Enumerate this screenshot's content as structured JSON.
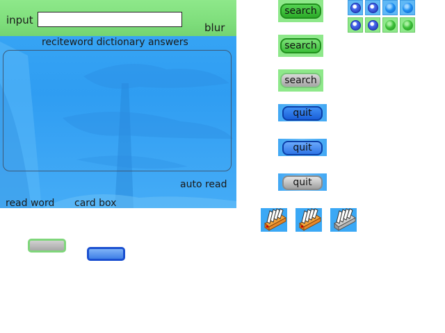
{
  "main": {
    "input_label": "input",
    "input_value": "",
    "blur_label": "blur",
    "answers_title": "reciteword dictionary answers",
    "auto_read_label": "auto read",
    "read_word_label": "read word",
    "card_box_label": "card box"
  },
  "search_buttons": [
    {
      "label": "search",
      "state": "normal"
    },
    {
      "label": "search",
      "state": "hover"
    },
    {
      "label": "search",
      "state": "disabled"
    }
  ],
  "quit_buttons": [
    {
      "label": "quit",
      "state": "normal"
    },
    {
      "label": "quit",
      "state": "hover"
    },
    {
      "label": "quit",
      "state": "disabled"
    }
  ],
  "radio_icons": [
    {
      "icon": "radio-blue-checked-icon",
      "background": "blue"
    },
    {
      "icon": "radio-blue-checked-icon",
      "background": "blue"
    },
    {
      "icon": "radio-blue-unchecked-icon",
      "background": "blue"
    },
    {
      "icon": "radio-blue-unchecked-icon",
      "background": "blue"
    },
    {
      "icon": "radio-blue-checked-icon",
      "background": "green"
    },
    {
      "icon": "radio-blue-checked-icon",
      "background": "green"
    },
    {
      "icon": "radio-green-unchecked-icon",
      "background": "green"
    },
    {
      "icon": "radio-green-unchecked-icon",
      "background": "green"
    }
  ],
  "cardbox_icons": [
    "card-box-icon",
    "card-box-icon",
    "card-box-grey-icon"
  ],
  "colors": {
    "panel_blue": "#3aa8f5",
    "bar_green": "#8ee88a",
    "button_green": "#2cab28",
    "button_blue": "#1a5fd8"
  }
}
